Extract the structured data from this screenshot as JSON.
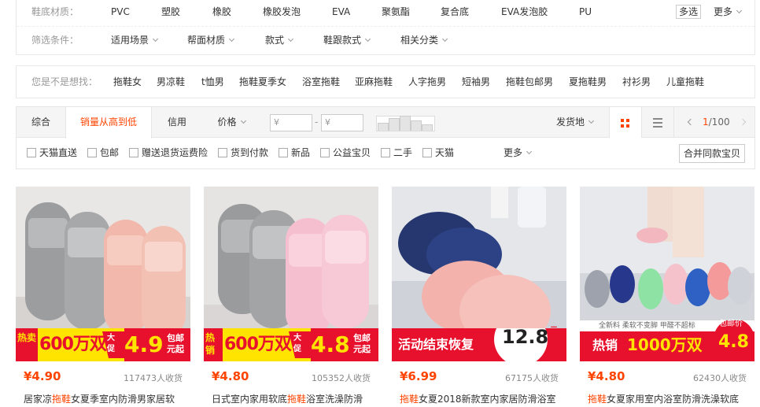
{
  "filters": {
    "sole_label": "鞋底材质：",
    "sole_options": [
      "PVC",
      "塑胶",
      "橡胶",
      "橡胶发泡",
      "EVA",
      "聚氨酯",
      "复合底",
      "EVA发泡胶",
      "PU"
    ],
    "multi_label": "多选",
    "more_label": "更多",
    "filter_label": "筛选条件：",
    "dropdowns": [
      "适用场景",
      "帮面材质",
      "款式",
      "鞋跟款式",
      "相关分类"
    ]
  },
  "suggest": {
    "label": "您是不是想找：",
    "items": [
      "拖鞋女",
      "男凉鞋",
      "t恤男",
      "拖鞋夏季女",
      "浴室拖鞋",
      "亚麻拖鞋",
      "人字拖男",
      "短袖男",
      "拖鞋包邮男",
      "夏拖鞋男",
      "衬衫男",
      "儿童拖鞋"
    ]
  },
  "sort": {
    "tabs": [
      "综合",
      "销量从高到低",
      "信用",
      "价格"
    ],
    "price_from_placeholder": "¥",
    "price_to_placeholder": "¥",
    "price_dash": "-",
    "ship_label": "发货地",
    "page_current": "1",
    "page_total": "/100"
  },
  "checks": {
    "items": [
      "天猫直送",
      "包邮",
      "赠送退货运费险",
      "货到付款",
      "新品",
      "公益宝贝",
      "二手",
      "天猫"
    ],
    "more_label": "更多",
    "merge_label": "合并同款宝贝"
  },
  "products": [
    {
      "price": "¥4.90",
      "sales": "117473人收货",
      "title_pre": "居家凉",
      "title_hl": "拖鞋",
      "title_post": "女夏季室内防滑男家居软",
      "banner_left": "热卖",
      "banner_mid": "600万双",
      "banner_tag": "大促",
      "banner_price": "4.9",
      "banner_right": "包邮元起"
    },
    {
      "price": "¥4.80",
      "sales": "105352人收货",
      "title_pre": "日式室内家用软底",
      "title_hl": "拖鞋",
      "title_post": "浴室洗澡防滑",
      "banner_left": "热销",
      "banner_mid": "600万双",
      "banner_tag": "大促",
      "banner_price": "4.8",
      "banner_right": "包邮元起"
    },
    {
      "price": "¥6.99",
      "sales": "67175人收货",
      "title_pre": "",
      "title_hl": "拖鞋",
      "title_post": "女夏2018新款室内家居防滑浴室",
      "banner_left": "活动结束恢复",
      "banner_price": "12.8",
      "banner_right": "元双"
    },
    {
      "price": "¥4.80",
      "sales": "62430人收货",
      "title_pre": "",
      "title_hl": "拖鞋",
      "title_post": "女夏家用室内浴室防滑洗澡软底",
      "banner_top": "全新料 柔软不变脚 甲醛不超标",
      "banner_left": "热销",
      "banner_mid": "1000万双",
      "banner_tag": "包邮价",
      "banner_price": "4.8"
    }
  ],
  "colors": {
    "accent": "#ff4400",
    "banner_red": "#e8112d",
    "banner_yellow": "#ffe400"
  }
}
